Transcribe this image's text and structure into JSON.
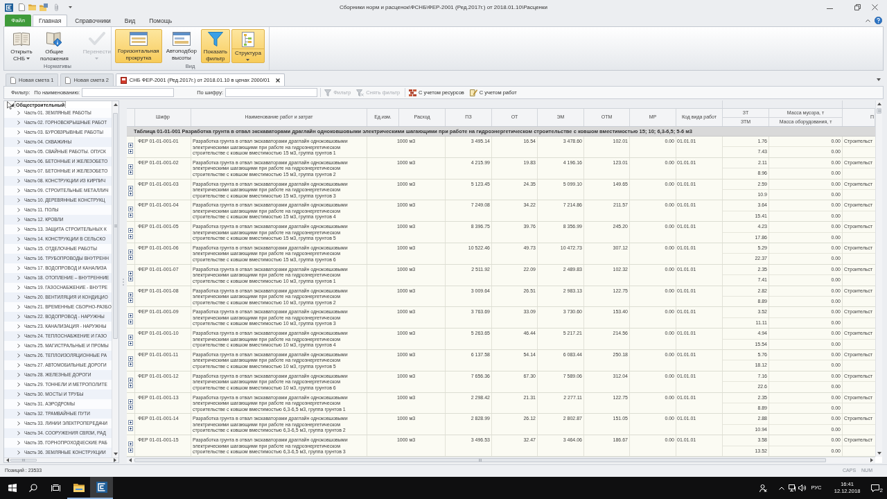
{
  "window": {
    "title": "Сборники норм и расценок\\ФСНБ\\ФЕР-2001 (Ред.2017г.) от 2018.01.10\\Расценки"
  },
  "ribbon": {
    "file_tab": "Файл",
    "tabs": [
      {
        "label": "Главная",
        "selected": true
      },
      {
        "label": "Справочники",
        "selected": false
      },
      {
        "label": "Вид",
        "selected": false
      },
      {
        "label": "Помощь",
        "selected": false
      }
    ],
    "groups": [
      {
        "label": "Нормативы",
        "buttons": [
          {
            "label": "Открыть СНБ",
            "kind": "dropdown",
            "on": false,
            "disabled": false
          },
          {
            "label": "Общие положения",
            "kind": "plain",
            "on": false,
            "disabled": false
          },
          {
            "label": "Перенести",
            "kind": "split",
            "on": false,
            "disabled": true
          }
        ]
      },
      {
        "label": "Вид",
        "buttons": [
          {
            "label": "Горизонтальная прокрутка",
            "kind": "plain",
            "on": true,
            "disabled": false
          },
          {
            "label": "Автоподбор высоты",
            "kind": "plain",
            "on": false,
            "disabled": false
          },
          {
            "label": "Показать фильтр",
            "kind": "plain",
            "on": true,
            "disabled": false
          },
          {
            "label": "Структура",
            "kind": "split",
            "on": true,
            "disabled": false
          }
        ]
      }
    ]
  },
  "document_tabs": [
    {
      "label": "Новая смета 1",
      "selected": false
    },
    {
      "label": "Новая смета 2",
      "selected": false
    },
    {
      "label": "СНБ ФЕР-2001 (Ред.2017г.) от 2018.01.10 в ценах 2000/01",
      "selected": true
    }
  ],
  "filter_bar": {
    "label": "Фильтр:",
    "fields": [
      {
        "label": "По наименованию:"
      },
      {
        "label": "По шифру:"
      }
    ],
    "buttons": [
      {
        "label": "Фильтр",
        "disabled": true
      },
      {
        "label": "Снять фильтр",
        "disabled": true
      },
      {
        "label": "С учетом ресурсов",
        "disabled": false
      },
      {
        "label": "С учетом работ",
        "disabled": false
      }
    ]
  },
  "tree": {
    "label": "Общестроительный",
    "expanded": true,
    "selected": true,
    "children": [
      {
        "label": "Часть 01. ЗЕМЛЯНЫЕ РАБОТЫ",
        "expanded": false,
        "selected": false
      },
      {
        "label": "Часть 02. ГОРНОВСКРЫШНЫЕ РАБОТ",
        "expanded": false,
        "selected": false
      },
      {
        "label": "Часть 03. БУРОВЗРЫВНЫЕ РАБОТЫ",
        "expanded": false,
        "selected": false
      },
      {
        "label": "Часть 04. СКВАЖИНЫ",
        "expanded": false,
        "selected": false
      },
      {
        "label": "Часть 05. СВАЙНЫЕ РАБОТЫ. ОПУСК",
        "expanded": false,
        "selected": false
      },
      {
        "label": "Часть 06. БЕТОННЫЕ И ЖЕЛЕЗОБЕТО",
        "expanded": false,
        "selected": false
      },
      {
        "label": "Часть 07. БЕТОННЫЕ И ЖЕЛЕЗОБЕТО",
        "expanded": false,
        "selected": false
      },
      {
        "label": "Часть 08. КОНСТРУКЦИИ ИЗ КИРПИЧ",
        "expanded": false,
        "selected": false
      },
      {
        "label": "Часть 09. СТРОИТЕЛЬНЫЕ МЕТАЛЛИЧ",
        "expanded": false,
        "selected": false
      },
      {
        "label": "Часть 10. ДЕРЕВЯННЫЕ КОНСТРУКЦ",
        "expanded": false,
        "selected": false
      },
      {
        "label": "Часть 11. ПОЛЫ",
        "expanded": false,
        "selected": false
      },
      {
        "label": "Часть 12. КРОВЛИ",
        "expanded": false,
        "selected": false
      },
      {
        "label": "Часть 13. ЗАЩИТА СТРОИТЕЛЬНЫХ К",
        "expanded": false,
        "selected": false
      },
      {
        "label": "Часть 14. КОНСТРУКЦИИ В СЕЛЬСКО",
        "expanded": false,
        "selected": false
      },
      {
        "label": "Часть 15. ОТДЕЛОЧНЫЕ РАБОТЫ",
        "expanded": false,
        "selected": false
      },
      {
        "label": "Часть 16. ТРУБОПРОВОДЫ ВНУТРЕНН",
        "expanded": false,
        "selected": false
      },
      {
        "label": "Часть 17. ВОДОПРОВОД И КАНАЛИЗА",
        "expanded": false,
        "selected": false
      },
      {
        "label": "Часть 18. ОТОПЛЕНИЕ – ВНУТРЕННИЕ",
        "expanded": false,
        "selected": false
      },
      {
        "label": "Часть 19. ГАЗОСНАБЖЕНИЕ - ВНУТРЕ",
        "expanded": false,
        "selected": false
      },
      {
        "label": "Часть 20. ВЕНТИЛЯЦИЯ И КОНДИЦИО",
        "expanded": false,
        "selected": false
      },
      {
        "label": "Часть 21. ВРЕМЕННЫЕ СБОРНО-РАЗБО",
        "expanded": false,
        "selected": false
      },
      {
        "label": "Часть 22. ВОДОПРОВОД - НАРУЖНЫ",
        "expanded": false,
        "selected": false
      },
      {
        "label": "Часть 23. КАНАЛИЗАЦИЯ - НАРУЖНЫ",
        "expanded": false,
        "selected": false
      },
      {
        "label": "Часть 24. ТЕПЛОСНАБЖЕНИЕ И ГАЗО",
        "expanded": false,
        "selected": false
      },
      {
        "label": "Часть 25. МАГИСТРАЛЬНЫЕ И ПРОМЫ",
        "expanded": false,
        "selected": false
      },
      {
        "label": "Часть 26. ТЕПЛОИЗОЛЯЦИОННЫЕ РА",
        "expanded": false,
        "selected": false
      },
      {
        "label": "Часть 27. АВТОМОБИЛЬНЫЕ ДОРОГИ",
        "expanded": false,
        "selected": false
      },
      {
        "label": "Часть 28. ЖЕЛЕЗНЫЕ ДОРОГИ",
        "expanded": false,
        "selected": false
      },
      {
        "label": "Часть 29. ТОННЕЛИ И МЕТРОПОЛИТЕ",
        "expanded": false,
        "selected": false
      },
      {
        "label": "Часть 30. МОСТЫ И ТРУБЫ",
        "expanded": false,
        "selected": false
      },
      {
        "label": "Часть 31. АЭРОДРОМЫ",
        "expanded": false,
        "selected": false
      },
      {
        "label": "Часть 32. ТРАМВАЙНЫЕ ПУТИ",
        "expanded": false,
        "selected": false
      },
      {
        "label": "Часть 33. ЛИНИИ ЭЛЕКТРОПЕРЕДАЧИ",
        "expanded": false,
        "selected": false
      },
      {
        "label": "Часть 34. СООРУЖЕНИЯ СВЯЗИ, РАД",
        "expanded": false,
        "selected": false
      },
      {
        "label": "Часть 35. ГОРНОПРОХОДЧЕСКИЕ РАБ",
        "expanded": false,
        "selected": false
      },
      {
        "label": "Часть 36. ЗЕМЛЯНЫЕ КОНСТРУКЦИИ",
        "expanded": false,
        "selected": false
      }
    ]
  },
  "table": {
    "columns": [
      {
        "kind": "single",
        "label": "Шифр"
      },
      {
        "kind": "single",
        "label": "Наименование работ и затрат"
      },
      {
        "kind": "single",
        "label": "Ед.изм."
      },
      {
        "kind": "single",
        "label": "Расход"
      },
      {
        "kind": "single",
        "label": "ПЗ"
      },
      {
        "kind": "single",
        "label": "ОТ"
      },
      {
        "kind": "single",
        "label": "ЭМ"
      },
      {
        "kind": "single",
        "label": "ОТМ"
      },
      {
        "kind": "single",
        "label": "МР"
      },
      {
        "kind": "single",
        "label": "Код вида работ"
      },
      {
        "kind": "stacked",
        "labels": [
          "ЗТ",
          "ЗТМ"
        ]
      },
      {
        "kind": "stacked",
        "labels": [
          "Масса мусора, т",
          "Масса оборудования, т"
        ]
      },
      {
        "kind": "cut",
        "label": "П"
      }
    ],
    "group_row": "Таблица 01-01-001 Разработка грунта в отвал экскаваторами драглайн одноковшовыми электрическими шагающими при работе на гидроэнергетическом строительстве с ковшом вместимостью 15; 10; 6,3-6,5; 5-6 м3",
    "rows": [
      {
        "code": "ФЕР 01-01-001-01",
        "name": "Разработка грунта в отвал экскаваторами драглайн одноковшовыми электрическими шагающими при работе на гидроэнергетическом строительстве с ковшом вместимостью 15 м3, группа грунтов 1",
        "unit": "1000 м3",
        "pz": "3 495.14",
        "ot": "16.54",
        "em": "3 478.60",
        "otm": "102.01",
        "mr": "0.00",
        "work_type_code": "01.01.01",
        "zt": "1.76",
        "ztm": "7.43",
        "debris_mass": "0.00",
        "equipment_mass": "0.00",
        "column_13": "Строительст",
        "expanded": false
      },
      {
        "code": "ФЕР 01-01-001-02",
        "name": "Разработка грунта в отвал экскаваторами драглайн одноковшовыми электрическими шагающими при работе на гидроэнергетическом строительстве с ковшом вместимостью 15 м3, группа грунтов 2",
        "unit": "1000 м3",
        "pz": "4 215.99",
        "ot": "19.83",
        "em": "4 196.16",
        "otm": "123.01",
        "mr": "0.00",
        "work_type_code": "01.01.01",
        "zt": "2.11",
        "ztm": "8.96",
        "debris_mass": "0.00",
        "equipment_mass": "0.00",
        "column_13": "Строительст",
        "expanded": false
      },
      {
        "code": "ФЕР 01-01-001-03",
        "name": "Разработка грунта в отвал экскаваторами драглайн одноковшовыми электрическими шагающими при работе на гидроэнергетическом строительстве с ковшом вместимостью 15 м3, группа грунтов 3",
        "unit": "1000 м3",
        "pz": "5 123.45",
        "ot": "24.35",
        "em": "5 099.10",
        "otm": "149.65",
        "mr": "0.00",
        "work_type_code": "01.01.01",
        "zt": "2.59",
        "ztm": "10.9",
        "debris_mass": "0.00",
        "equipment_mass": "0.00",
        "column_13": "Строительст",
        "expanded": false
      },
      {
        "code": "ФЕР 01-01-001-04",
        "name": "Разработка грунта в отвал экскаваторами драглайн одноковшовыми электрическими шагающими при работе на гидроэнергетическом строительстве с ковшом вместимостью 15 м3, группа грунтов 4",
        "unit": "1000 м3",
        "pz": "7 249.08",
        "ot": "34.22",
        "em": "7 214.86",
        "otm": "211.57",
        "mr": "0.00",
        "work_type_code": "01.01.01",
        "zt": "3.64",
        "ztm": "15.41",
        "debris_mass": "0.00",
        "equipment_mass": "0.00",
        "column_13": "Строительст",
        "expanded": false
      },
      {
        "code": "ФЕР 01-01-001-05",
        "name": "Разработка грунта в отвал экскаваторами драглайн одноковшовыми электрическими шагающими при работе на гидроэнергетическом строительстве с ковшом вместимостью 15 м3, группа грунтов 5",
        "unit": "1000 м3",
        "pz": "8 396.75",
        "ot": "39.76",
        "em": "8 356.99",
        "otm": "245.20",
        "mr": "0.00",
        "work_type_code": "01.01.01",
        "zt": "4.23",
        "ztm": "17.86",
        "debris_mass": "0.00",
        "equipment_mass": "0.00",
        "column_13": "Строительст",
        "expanded": false
      },
      {
        "code": "ФЕР 01-01-001-06",
        "name": "Разработка грунта в отвал экскаваторами драглайн одноковшовыми электрическими шагающими при работе на гидроэнергетическом строительстве с ковшом вместимостью 15 м3, группа грунтов 6",
        "unit": "1000 м3",
        "pz": "10 522.46",
        "ot": "49.73",
        "em": "10 472.73",
        "otm": "307.12",
        "mr": "0.00",
        "work_type_code": "01.01.01",
        "zt": "5.29",
        "ztm": "22.37",
        "debris_mass": "0.00",
        "equipment_mass": "0.00",
        "column_13": "Строительст",
        "expanded": false
      },
      {
        "code": "ФЕР 01-01-001-07",
        "name": "Разработка грунта в отвал экскаваторами драглайн одноковшовыми электрическими шагающими при работе на гидроэнергетическом строительстве с ковшом вместимостью 10 м3, группа грунтов 1",
        "unit": "1000 м3",
        "pz": "2 511.92",
        "ot": "22.09",
        "em": "2 489.83",
        "otm": "102.32",
        "mr": "0.00",
        "work_type_code": "01.01.01",
        "zt": "2.35",
        "ztm": "7.41",
        "debris_mass": "0.00",
        "equipment_mass": "0.00",
        "column_13": "Строительст",
        "expanded": false
      },
      {
        "code": "ФЕР 01-01-001-08",
        "name": "Разработка грунта в отвал экскаваторами драглайн одноковшовыми электрическими шагающими при работе на гидроэнергетическом строительстве с ковшом вместимостью 10 м3, группа грунтов 2",
        "unit": "1000 м3",
        "pz": "3 009.64",
        "ot": "26.51",
        "em": "2 983.13",
        "otm": "122.75",
        "mr": "0.00",
        "work_type_code": "01.01.01",
        "zt": "2.82",
        "ztm": "8.89",
        "debris_mass": "0.00",
        "equipment_mass": "0.00",
        "column_13": "Строительст",
        "expanded": false
      },
      {
        "code": "ФЕР 01-01-001-09",
        "name": "Разработка грунта в отвал экскаваторами драглайн одноковшовыми электрическими шагающими при работе на гидроэнергетическом строительстве с ковшом вместимостью 10 м3, группа грунтов 3",
        "unit": "1000 м3",
        "pz": "3 763.69",
        "ot": "33.09",
        "em": "3 730.60",
        "otm": "153.40",
        "mr": "0.00",
        "work_type_code": "01.01.01",
        "zt": "3.52",
        "ztm": "11.11",
        "debris_mass": "0.00",
        "equipment_mass": "0.00",
        "column_13": "Строительст",
        "expanded": false
      },
      {
        "code": "ФЕР 01-01-001-10",
        "name": "Разработка грунта в отвал экскаваторами драглайн одноковшовыми электрическими шагающими при работе на гидроэнергетическом строительстве с ковшом вместимостью 10 м3, группа грунтов 4",
        "unit": "1000 м3",
        "pz": "5 263.65",
        "ot": "46.44",
        "em": "5 217.21",
        "otm": "214.56",
        "mr": "0.00",
        "work_type_code": "01.01.01",
        "zt": "4.94",
        "ztm": "15.54",
        "debris_mass": "0.00",
        "equipment_mass": "0.00",
        "column_13": "Строительст",
        "expanded": false
      },
      {
        "code": "ФЕР 01-01-001-11",
        "name": "Разработка грунта в отвал экскаваторами драглайн одноковшовыми электрическими шагающими при работе на гидроэнергетическом строительстве с ковшом вместимостью 10 м3, группа грунтов 5",
        "unit": "1000 м3",
        "pz": "6 137.58",
        "ot": "54.14",
        "em": "6 083.44",
        "otm": "250.18",
        "mr": "0.00",
        "work_type_code": "01.01.01",
        "zt": "5.76",
        "ztm": "18.12",
        "debris_mass": "0.00",
        "equipment_mass": "0.00",
        "column_13": "Строительст",
        "expanded": false
      },
      {
        "code": "ФЕР 01-01-001-12",
        "name": "Разработка грунта в отвал экскаваторами драглайн одноковшовыми электрическими шагающими при работе на гидроэнергетическом строительстве с ковшом вместимостью 10 м3, группа грунтов 6",
        "unit": "1000 м3",
        "pz": "7 656.36",
        "ot": "67.30",
        "em": "7 589.06",
        "otm": "312.04",
        "mr": "0.00",
        "work_type_code": "01.01.01",
        "zt": "7.16",
        "ztm": "22.6",
        "debris_mass": "0.00",
        "equipment_mass": "0.00",
        "column_13": "Строительст",
        "expanded": false
      },
      {
        "code": "ФЕР 01-01-001-13",
        "name": "Разработка грунта в отвал экскаваторами драглайн одноковшовыми электрическими шагающими при работе на гидроэнергетическом строительстве с ковшом вместимостью 6,3-6,5 м3, группа грунтов 1",
        "unit": "1000 м3",
        "pz": "2 298.42",
        "ot": "21.31",
        "em": "2 277.11",
        "otm": "122.75",
        "mr": "0.00",
        "work_type_code": "01.01.01",
        "zt": "2.35",
        "ztm": "8.89",
        "debris_mass": "0.00",
        "equipment_mass": "0.00",
        "column_13": "Строительст",
        "expanded": false
      },
      {
        "code": "ФЕР 01-01-001-14",
        "name": "Разработка грунта в отвал экскаваторами драглайн одноковшовыми электрическими шагающими при работе на гидроэнергетическом строительстве с ковшом вместимостью 6,3-6,5 м3, группа грунтов 2",
        "unit": "1000 м3",
        "pz": "2 828.99",
        "ot": "26.12",
        "em": "2 802.87",
        "otm": "151.05",
        "mr": "0.00",
        "work_type_code": "01.01.01",
        "zt": "2.88",
        "ztm": "10.94",
        "debris_mass": "0.00",
        "equipment_mass": "0.00",
        "column_13": "Строительст",
        "expanded": false
      },
      {
        "code": "ФЕР 01-01-001-15",
        "name": "Разработка грунта в отвал экскаваторами драглайн одноковшовыми электрическими шагающими при работе на гидроэнергетическом строительстве с ковшом вместимостью 6,3-6,5 м3, группа грунтов 3",
        "unit": "1000 м3",
        "pz": "3 496.53",
        "ot": "32.47",
        "em": "3 464.06",
        "otm": "186.67",
        "mr": "0.00",
        "work_type_code": "01.01.01",
        "zt": "3.58",
        "ztm": "13.52",
        "debris_mass": "0.00",
        "equipment_mass": "0.00",
        "column_13": "Строительст",
        "expanded": false
      }
    ]
  },
  "status_bar": {
    "position": "Позиций : 23533",
    "indicators": [
      {
        "label": "CAPS",
        "on": false
      },
      {
        "label": "NUM",
        "on": false
      }
    ]
  },
  "taskbar": {
    "apps": [
      {
        "active": false
      },
      {
        "active": true
      }
    ],
    "language": "РУС",
    "time": "16:41",
    "date": "12.12.2018",
    "notifications": "2"
  }
}
